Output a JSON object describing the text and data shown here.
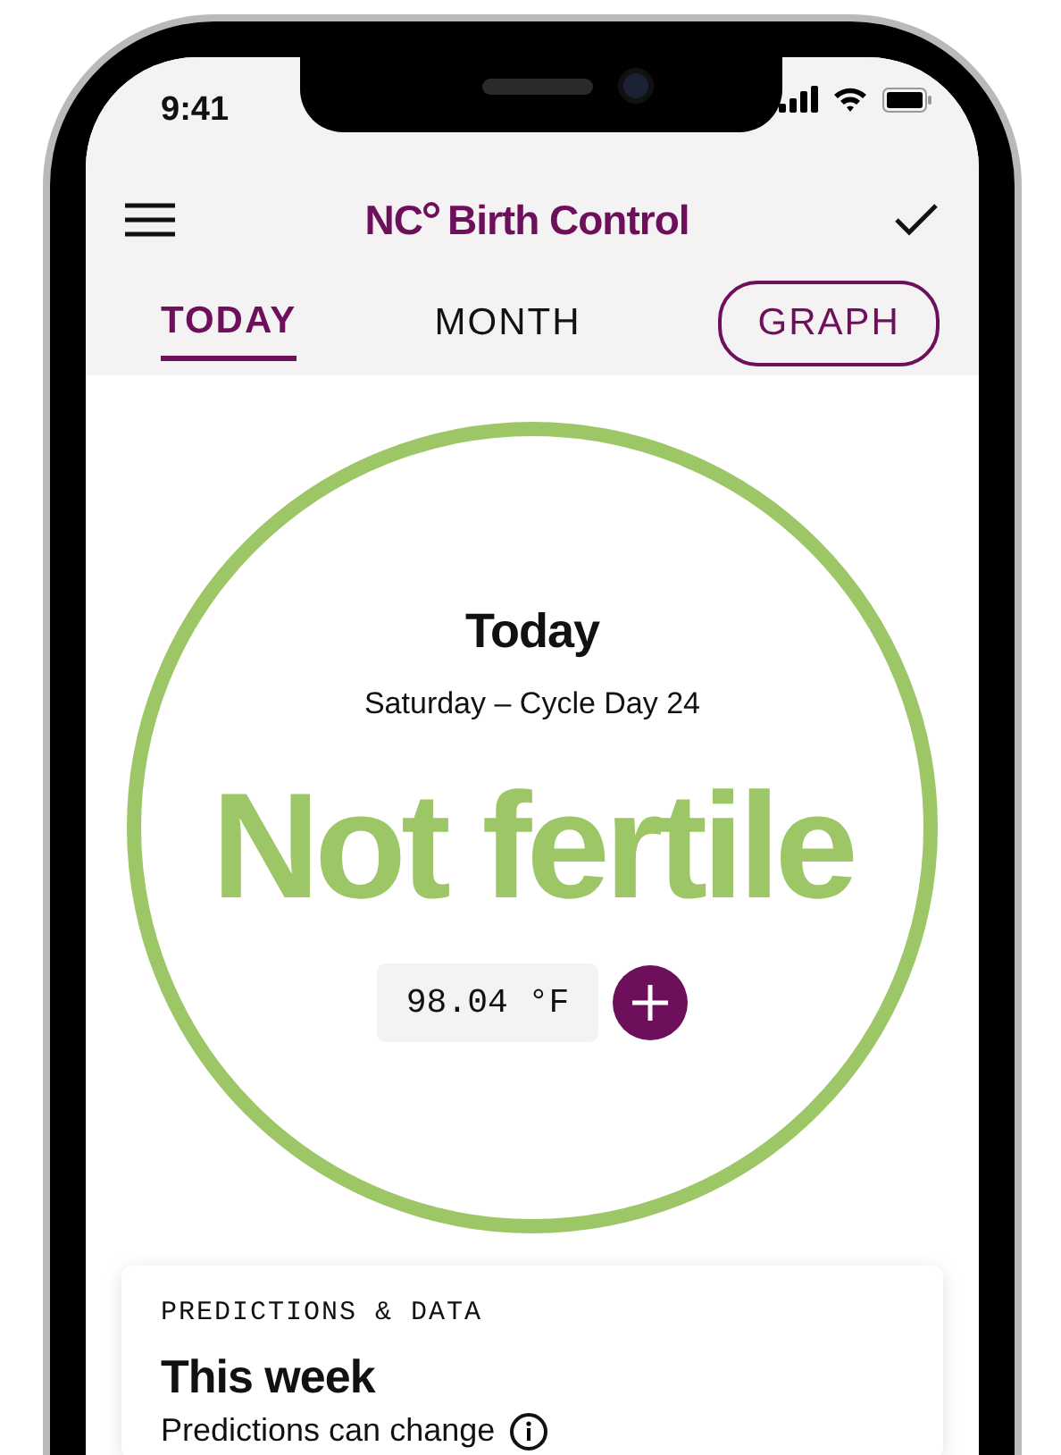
{
  "status_bar": {
    "time": "9:41"
  },
  "header": {
    "logo_mark": "NC",
    "title": "Birth Control"
  },
  "tabs": [
    {
      "label": "TODAY",
      "selected": true,
      "kind": "underline"
    },
    {
      "label": "MONTH",
      "selected": false,
      "kind": "plain"
    },
    {
      "label": "GRAPH",
      "selected": false,
      "kind": "outlined"
    }
  ],
  "status": {
    "heading": "Today",
    "subtitle": "Saturday – Cycle Day 24",
    "fertility": "Not fertile"
  },
  "temperature": {
    "value": "98.04 °F"
  },
  "card": {
    "eyebrow": "PREDICTIONS & DATA",
    "title": "This week",
    "note": "Predictions can change"
  }
}
